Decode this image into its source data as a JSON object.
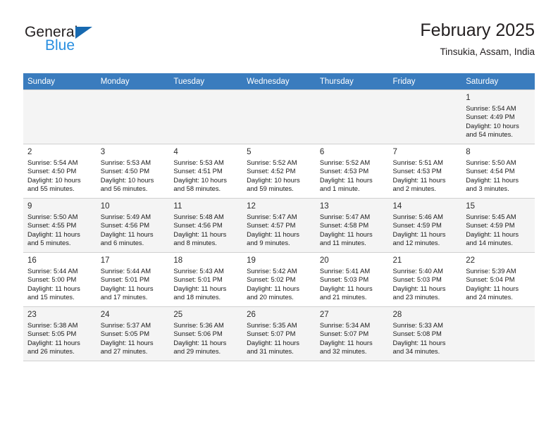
{
  "brand": {
    "name_part1": "General",
    "name_part2": "Blue",
    "triangle_color": "#1769b0",
    "blue_color": "#2a8fe0"
  },
  "header": {
    "title": "February 2025",
    "subtitle": "Tinsukia, Assam, India"
  },
  "theme": {
    "header_row_bg": "#3a7cbe",
    "header_row_text": "#ffffff",
    "alt_row_bg": "#f4f4f4",
    "grid_line": "#d0d0d0"
  },
  "weekday_headers": [
    "Sunday",
    "Monday",
    "Tuesday",
    "Wednesday",
    "Thursday",
    "Friday",
    "Saturday"
  ],
  "calendar": {
    "month": "February",
    "year": "2025",
    "weeks": [
      [
        {
          "empty": true
        },
        {
          "empty": true
        },
        {
          "empty": true
        },
        {
          "empty": true
        },
        {
          "empty": true
        },
        {
          "empty": true
        },
        {
          "day": "1",
          "sunrise": "Sunrise: 5:54 AM",
          "sunset": "Sunset: 4:49 PM",
          "daylight_line1": "Daylight: 10 hours",
          "daylight_line2": "and 54 minutes."
        }
      ],
      [
        {
          "day": "2",
          "sunrise": "Sunrise: 5:54 AM",
          "sunset": "Sunset: 4:50 PM",
          "daylight_line1": "Daylight: 10 hours",
          "daylight_line2": "and 55 minutes."
        },
        {
          "day": "3",
          "sunrise": "Sunrise: 5:53 AM",
          "sunset": "Sunset: 4:50 PM",
          "daylight_line1": "Daylight: 10 hours",
          "daylight_line2": "and 56 minutes."
        },
        {
          "day": "4",
          "sunrise": "Sunrise: 5:53 AM",
          "sunset": "Sunset: 4:51 PM",
          "daylight_line1": "Daylight: 10 hours",
          "daylight_line2": "and 58 minutes."
        },
        {
          "day": "5",
          "sunrise": "Sunrise: 5:52 AM",
          "sunset": "Sunset: 4:52 PM",
          "daylight_line1": "Daylight: 10 hours",
          "daylight_line2": "and 59 minutes."
        },
        {
          "day": "6",
          "sunrise": "Sunrise: 5:52 AM",
          "sunset": "Sunset: 4:53 PM",
          "daylight_line1": "Daylight: 11 hours",
          "daylight_line2": "and 1 minute."
        },
        {
          "day": "7",
          "sunrise": "Sunrise: 5:51 AM",
          "sunset": "Sunset: 4:53 PM",
          "daylight_line1": "Daylight: 11 hours",
          "daylight_line2": "and 2 minutes."
        },
        {
          "day": "8",
          "sunrise": "Sunrise: 5:50 AM",
          "sunset": "Sunset: 4:54 PM",
          "daylight_line1": "Daylight: 11 hours",
          "daylight_line2": "and 3 minutes."
        }
      ],
      [
        {
          "day": "9",
          "sunrise": "Sunrise: 5:50 AM",
          "sunset": "Sunset: 4:55 PM",
          "daylight_line1": "Daylight: 11 hours",
          "daylight_line2": "and 5 minutes."
        },
        {
          "day": "10",
          "sunrise": "Sunrise: 5:49 AM",
          "sunset": "Sunset: 4:56 PM",
          "daylight_line1": "Daylight: 11 hours",
          "daylight_line2": "and 6 minutes."
        },
        {
          "day": "11",
          "sunrise": "Sunrise: 5:48 AM",
          "sunset": "Sunset: 4:56 PM",
          "daylight_line1": "Daylight: 11 hours",
          "daylight_line2": "and 8 minutes."
        },
        {
          "day": "12",
          "sunrise": "Sunrise: 5:47 AM",
          "sunset": "Sunset: 4:57 PM",
          "daylight_line1": "Daylight: 11 hours",
          "daylight_line2": "and 9 minutes."
        },
        {
          "day": "13",
          "sunrise": "Sunrise: 5:47 AM",
          "sunset": "Sunset: 4:58 PM",
          "daylight_line1": "Daylight: 11 hours",
          "daylight_line2": "and 11 minutes."
        },
        {
          "day": "14",
          "sunrise": "Sunrise: 5:46 AM",
          "sunset": "Sunset: 4:59 PM",
          "daylight_line1": "Daylight: 11 hours",
          "daylight_line2": "and 12 minutes."
        },
        {
          "day": "15",
          "sunrise": "Sunrise: 5:45 AM",
          "sunset": "Sunset: 4:59 PM",
          "daylight_line1": "Daylight: 11 hours",
          "daylight_line2": "and 14 minutes."
        }
      ],
      [
        {
          "day": "16",
          "sunrise": "Sunrise: 5:44 AM",
          "sunset": "Sunset: 5:00 PM",
          "daylight_line1": "Daylight: 11 hours",
          "daylight_line2": "and 15 minutes."
        },
        {
          "day": "17",
          "sunrise": "Sunrise: 5:44 AM",
          "sunset": "Sunset: 5:01 PM",
          "daylight_line1": "Daylight: 11 hours",
          "daylight_line2": "and 17 minutes."
        },
        {
          "day": "18",
          "sunrise": "Sunrise: 5:43 AM",
          "sunset": "Sunset: 5:01 PM",
          "daylight_line1": "Daylight: 11 hours",
          "daylight_line2": "and 18 minutes."
        },
        {
          "day": "19",
          "sunrise": "Sunrise: 5:42 AM",
          "sunset": "Sunset: 5:02 PM",
          "daylight_line1": "Daylight: 11 hours",
          "daylight_line2": "and 20 minutes."
        },
        {
          "day": "20",
          "sunrise": "Sunrise: 5:41 AM",
          "sunset": "Sunset: 5:03 PM",
          "daylight_line1": "Daylight: 11 hours",
          "daylight_line2": "and 21 minutes."
        },
        {
          "day": "21",
          "sunrise": "Sunrise: 5:40 AM",
          "sunset": "Sunset: 5:03 PM",
          "daylight_line1": "Daylight: 11 hours",
          "daylight_line2": "and 23 minutes."
        },
        {
          "day": "22",
          "sunrise": "Sunrise: 5:39 AM",
          "sunset": "Sunset: 5:04 PM",
          "daylight_line1": "Daylight: 11 hours",
          "daylight_line2": "and 24 minutes."
        }
      ],
      [
        {
          "day": "23",
          "sunrise": "Sunrise: 5:38 AM",
          "sunset": "Sunset: 5:05 PM",
          "daylight_line1": "Daylight: 11 hours",
          "daylight_line2": "and 26 minutes."
        },
        {
          "day": "24",
          "sunrise": "Sunrise: 5:37 AM",
          "sunset": "Sunset: 5:05 PM",
          "daylight_line1": "Daylight: 11 hours",
          "daylight_line2": "and 27 minutes."
        },
        {
          "day": "25",
          "sunrise": "Sunrise: 5:36 AM",
          "sunset": "Sunset: 5:06 PM",
          "daylight_line1": "Daylight: 11 hours",
          "daylight_line2": "and 29 minutes."
        },
        {
          "day": "26",
          "sunrise": "Sunrise: 5:35 AM",
          "sunset": "Sunset: 5:07 PM",
          "daylight_line1": "Daylight: 11 hours",
          "daylight_line2": "and 31 minutes."
        },
        {
          "day": "27",
          "sunrise": "Sunrise: 5:34 AM",
          "sunset": "Sunset: 5:07 PM",
          "daylight_line1": "Daylight: 11 hours",
          "daylight_line2": "and 32 minutes."
        },
        {
          "day": "28",
          "sunrise": "Sunrise: 5:33 AM",
          "sunset": "Sunset: 5:08 PM",
          "daylight_line1": "Daylight: 11 hours",
          "daylight_line2": "and 34 minutes."
        },
        {
          "empty": true
        }
      ]
    ]
  }
}
